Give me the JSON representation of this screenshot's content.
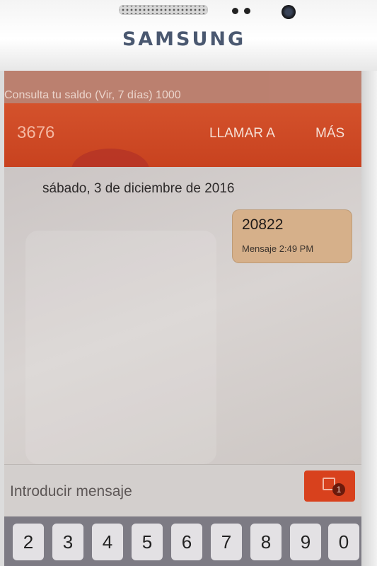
{
  "device": {
    "brand": "SAMSUNG"
  },
  "ticker": {
    "text": "Consulta tu saldo (Vir, 7 días) 1000"
  },
  "header": {
    "contact_number": "3676",
    "call_label": "LLAMAR A",
    "more_label": "MÁS"
  },
  "conversation": {
    "date": "sábado, 3 de diciembre de 2016",
    "messages": [
      {
        "text": "20822",
        "meta": "Mensaje 2:49 PM"
      }
    ]
  },
  "composer": {
    "placeholder": "Introducir mensaje",
    "send_badge": "1"
  },
  "keyboard": {
    "keys": [
      "2",
      "3",
      "4",
      "5",
      "6",
      "7",
      "8",
      "9",
      "0"
    ]
  }
}
